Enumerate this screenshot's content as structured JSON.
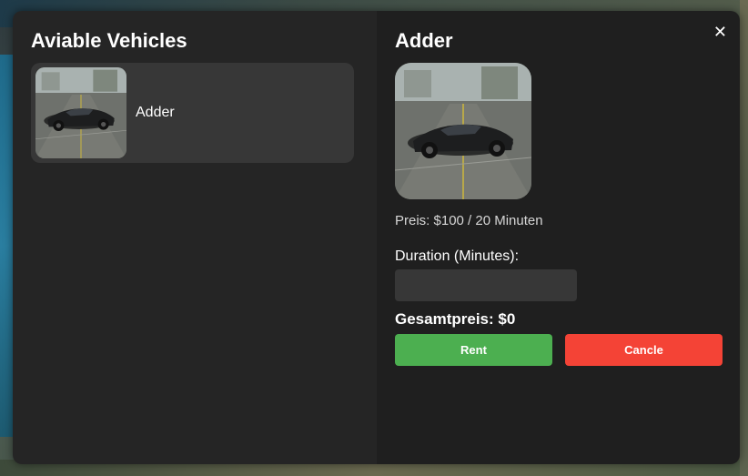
{
  "list_panel": {
    "title": "Aviable Vehicles",
    "vehicles": [
      {
        "name": "Adder",
        "image": "adder-car-photo"
      }
    ]
  },
  "detail_panel": {
    "title": "Adder",
    "image": "adder-car-photo",
    "price_text": "Preis: $100 / 20 Minuten",
    "duration_label": "Duration (Minutes):",
    "duration_value": "",
    "duration_placeholder": "",
    "total_text": "Gesamtpreis: $0",
    "rent_label": "Rent",
    "cancel_label": "Cancle",
    "close_glyph": "✕"
  },
  "colors": {
    "left_panel_bg": "#252525",
    "right_panel_bg": "#1f1f1f",
    "item_bg": "#373737",
    "rent_green": "#4caf50",
    "cancel_red": "#f44336"
  },
  "icons": {
    "close": "close-icon"
  }
}
